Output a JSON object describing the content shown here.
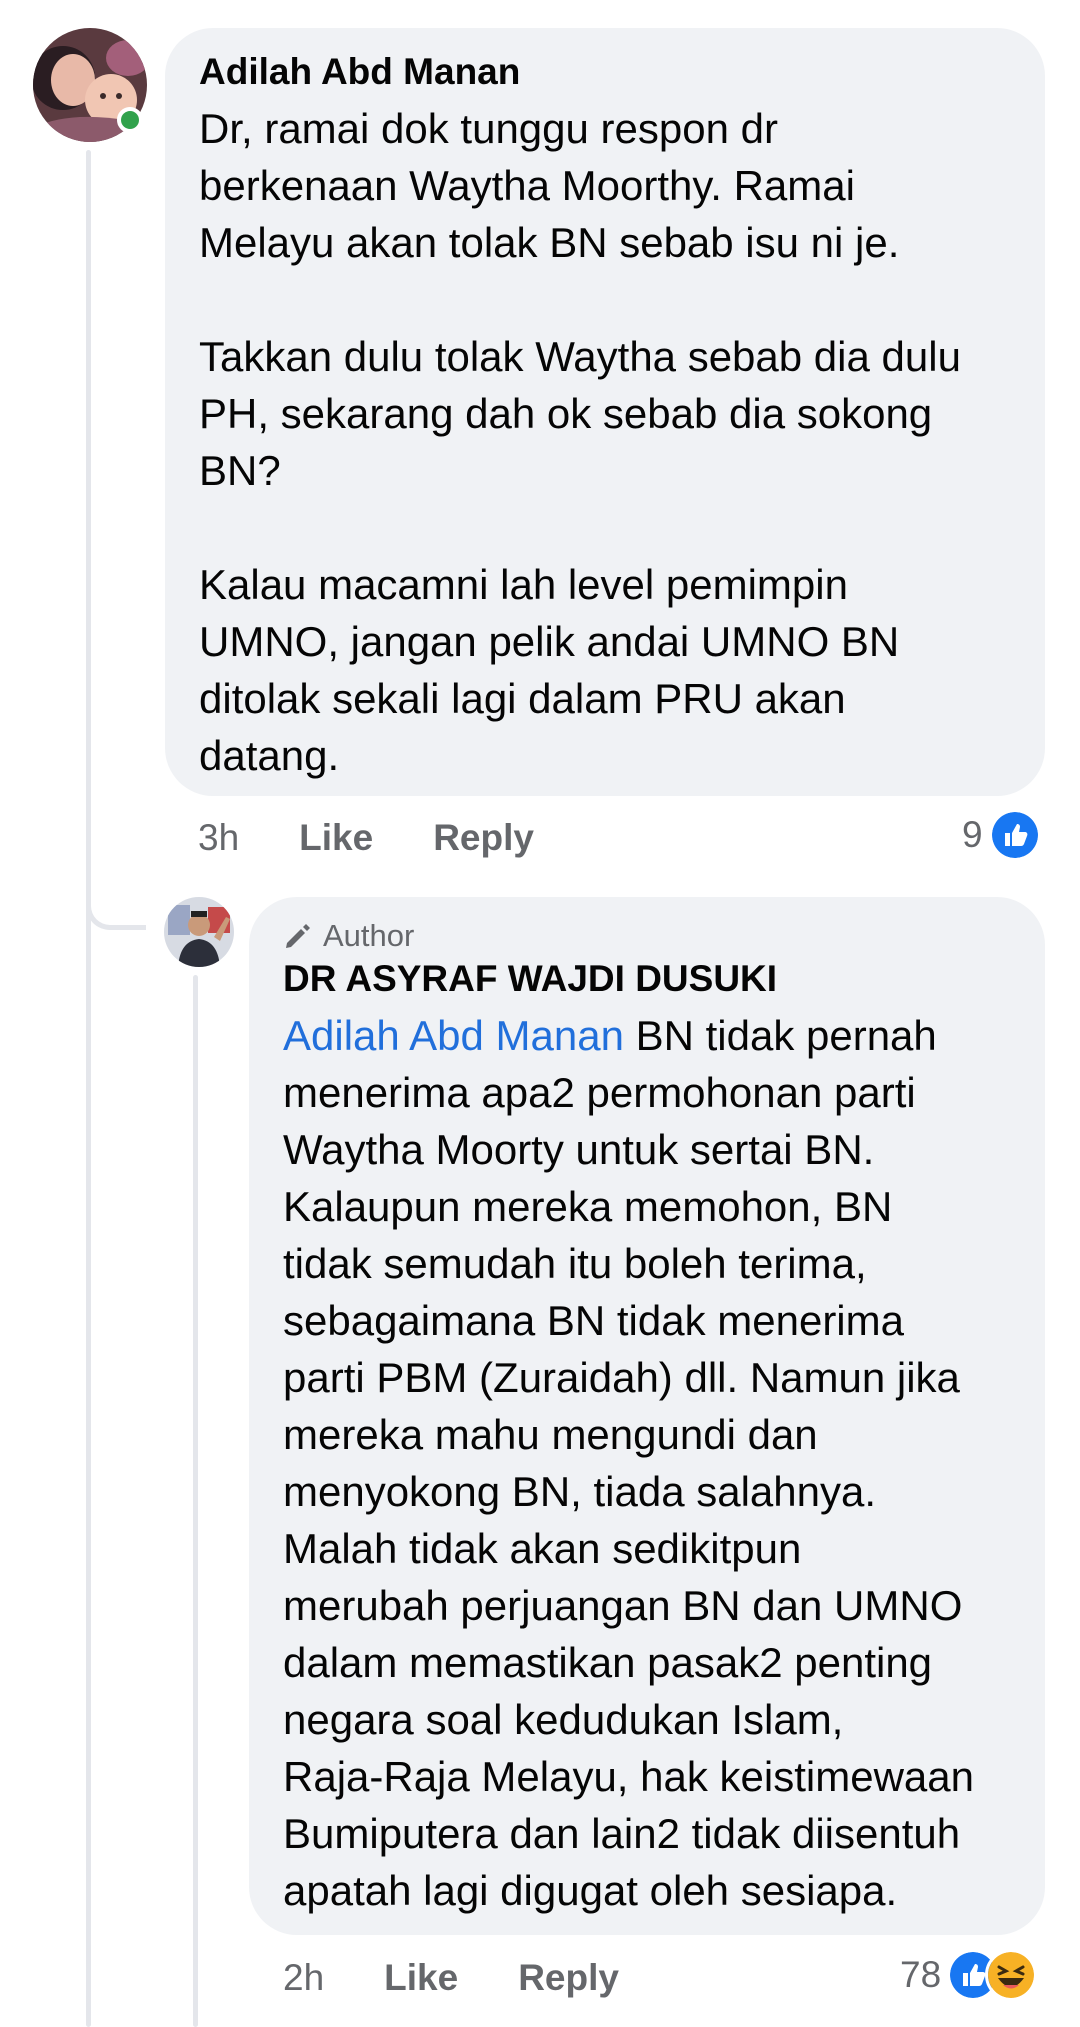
{
  "comment": {
    "author": "Adilah Abd Manan",
    "text": "Dr, ramai dok tunggu respon dr\nberkenaan Waytha Moorthy. Ramai\nMelayu akan tolak BN sebab isu ni je.\n\nTakkan dulu tolak Waytha sebab dia dulu\nPH, sekarang dah ok sebab dia sokong\nBN?\n\nKalau macamni lah level pemimpin\nUMNO, jangan pelik andai UMNO BN\nditolak sekali lagi dalam PRU akan\ndatang.",
    "time": "3h",
    "like_label": "Like",
    "reply_label": "Reply",
    "reaction_count": "9"
  },
  "reply": {
    "badge": "Author",
    "author": "DR ASYRAF WAJDI DUSUKI",
    "mention": "Adilah Abd Manan",
    "text": " BN tidak pernah\nmenerima apa2 permohonan parti\nWaytha Moorty untuk sertai BN.\nKalaupun mereka memohon, BN\ntidak semudah itu boleh terima,\nsebagaimana BN tidak menerima\nparti PBM (Zuraidah) dll. Namun jika\nmereka mahu mengundi dan\nmenyokong BN, tiada salahnya.\nMalah tidak akan sedikitpun\nmerubah perjuangan BN dan UMNO\ndalam memastikan pasak2 penting\nnegara soal kedudukan Islam,\nRaja-Raja Melayu, hak keistimewaan\nBumiputera dan lain2 tidak diisentuh\napatah lagi digugat oleh sesiapa.",
    "time": "2h",
    "like_label": "Like",
    "reply_label": "Reply",
    "reaction_count": "78"
  },
  "colors": {
    "bubble": "#f0f2f5",
    "thread_line": "#e4e6eb",
    "mention": "#216fdb",
    "meta": "#65676b",
    "online": "#31a24c",
    "like_reaction": "#1877f2",
    "haha_reaction": "#f7b125"
  }
}
